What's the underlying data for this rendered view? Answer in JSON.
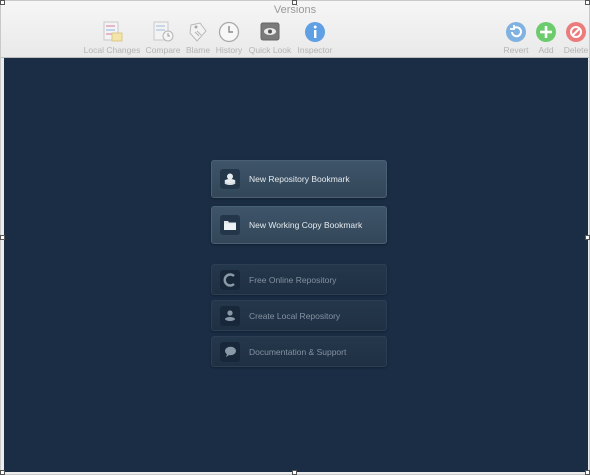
{
  "window": {
    "title": "Versions"
  },
  "toolbar": {
    "left": [
      {
        "label": "Local Changes",
        "icon": "local-changes-icon"
      },
      {
        "label": "Compare",
        "icon": "compare-icon"
      },
      {
        "label": "Blame",
        "icon": "blame-icon"
      },
      {
        "label": "History",
        "icon": "history-icon"
      },
      {
        "label": "Quick Look",
        "icon": "quick-look-icon"
      },
      {
        "label": "Inspector",
        "icon": "inspector-icon"
      }
    ],
    "right": [
      {
        "label": "Revert",
        "icon": "revert-icon"
      },
      {
        "label": "Add",
        "icon": "add-icon"
      },
      {
        "label": "Delete",
        "icon": "delete-icon"
      }
    ]
  },
  "actions": {
    "primary": [
      {
        "label": "New Repository Bookmark",
        "icon": "repository-icon"
      },
      {
        "label": "New Working Copy Bookmark",
        "icon": "folder-icon"
      }
    ],
    "secondary": [
      {
        "label": "Free Online Repository",
        "icon": "online-repository-icon"
      },
      {
        "label": "Create Local Repository",
        "icon": "local-repository-icon"
      },
      {
        "label": "Documentation & Support",
        "icon": "speech-bubble-icon"
      }
    ]
  },
  "colors": {
    "content_background": "#1a2d45",
    "revert": "#7fb2e0",
    "add": "#6ccb6c",
    "delete": "#ec7b7b",
    "inspector": "#5f9fe3"
  }
}
